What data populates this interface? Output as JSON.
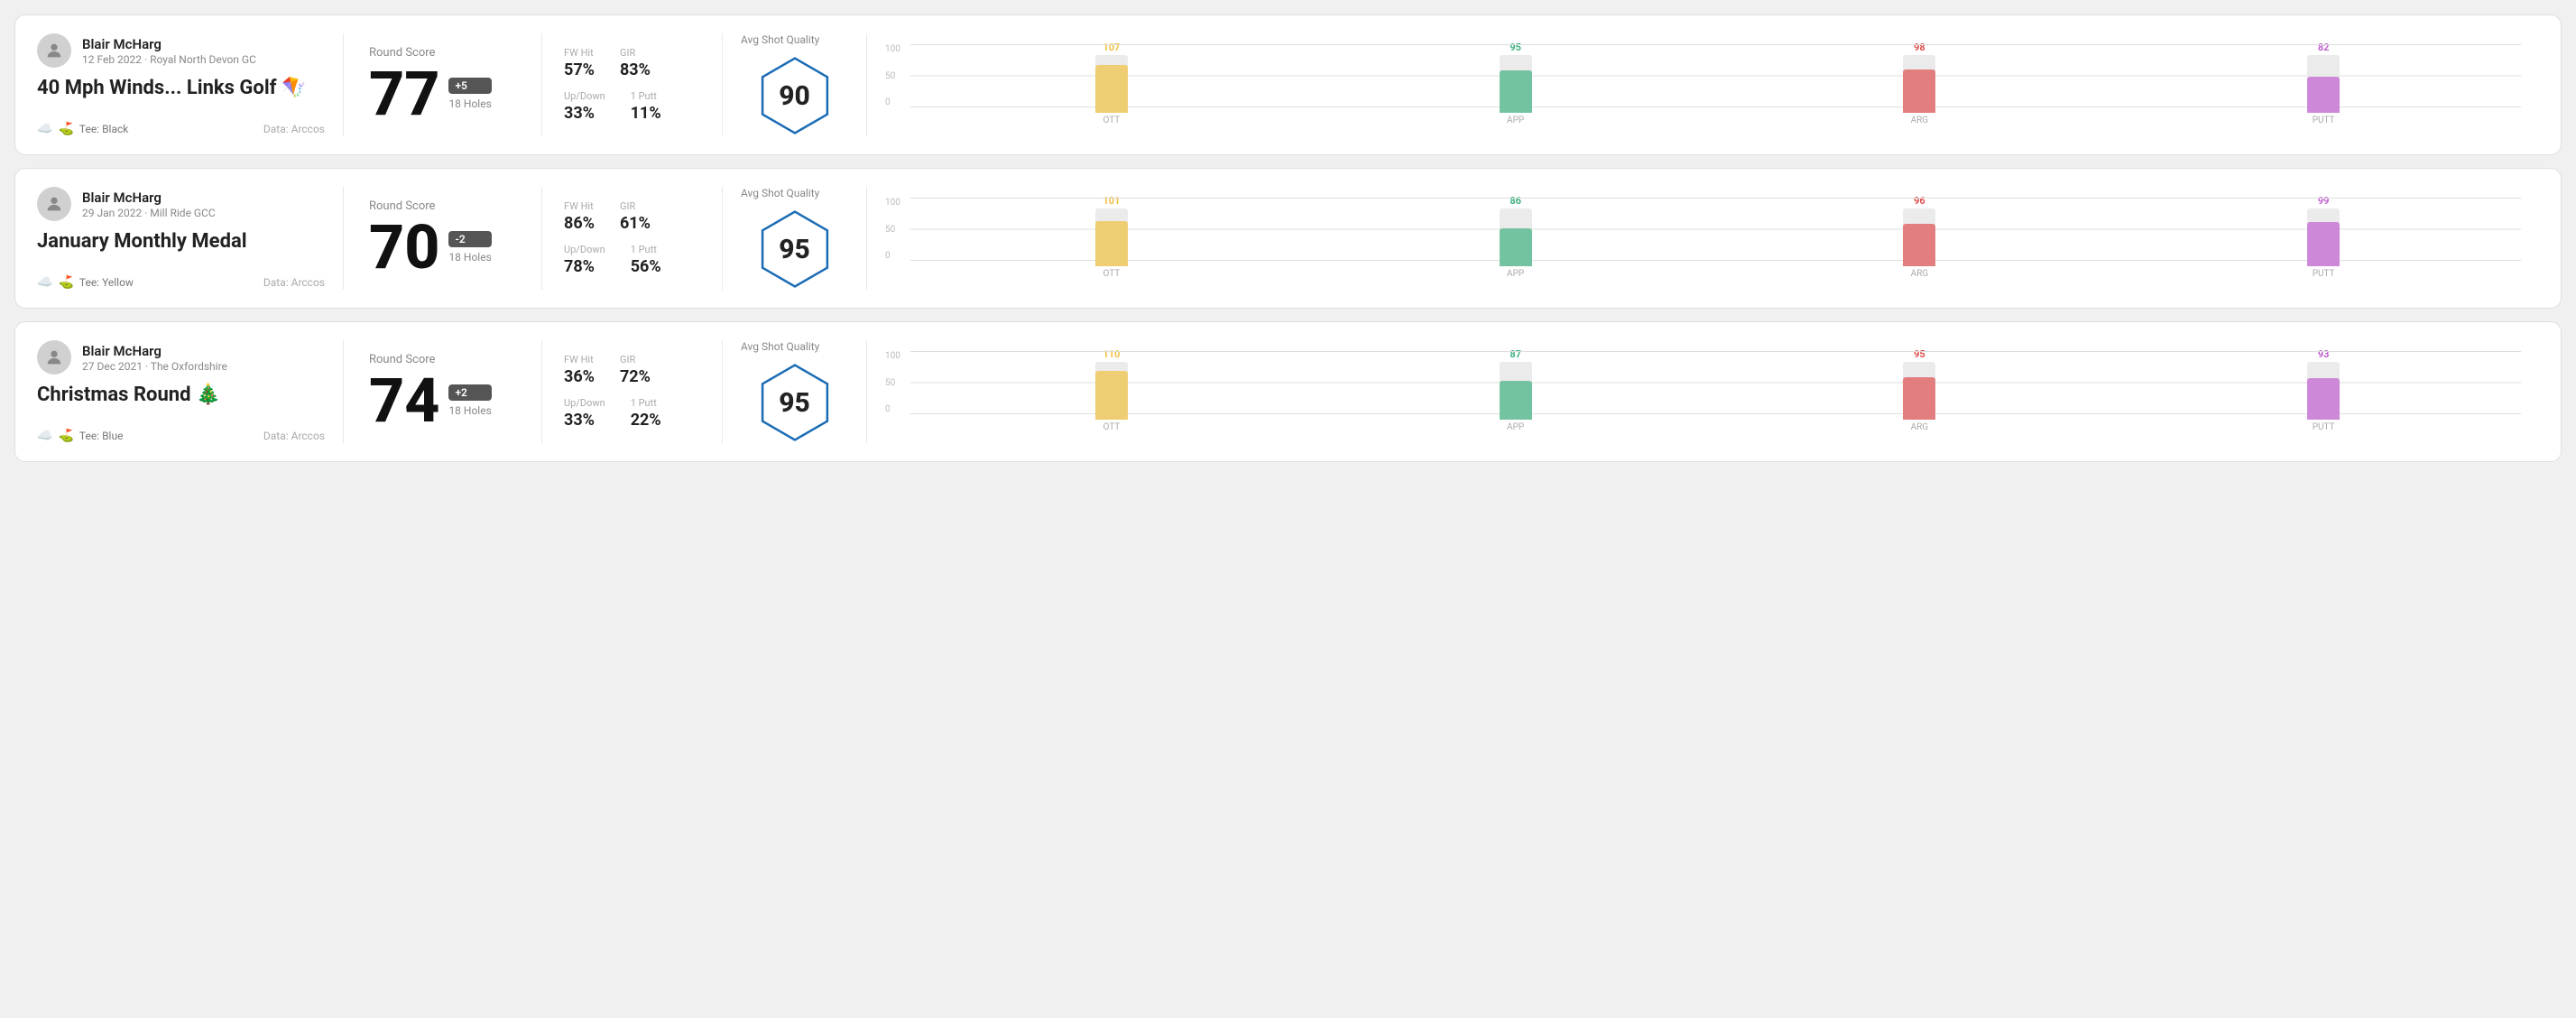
{
  "rounds": [
    {
      "id": "round-1",
      "user": {
        "name": "Blair McHarg",
        "date_course": "12 Feb 2022 · Royal North Devon GC"
      },
      "title": "40 Mph Winds... Links Golf 🪁",
      "tee": "Black",
      "data_source": "Data: Arccos",
      "score": "77",
      "score_diff": "+5",
      "holes": "18 Holes",
      "fw_hit": "57%",
      "gir": "83%",
      "up_down": "33%",
      "one_putt": "11%",
      "avg_quality": "90",
      "quality_label": "Avg Shot Quality",
      "chart": {
        "bars": [
          {
            "label": "OTT",
            "value": 107,
            "color": "#f0c040",
            "max": 130
          },
          {
            "label": "APP",
            "value": 95,
            "color": "#40b080",
            "max": 130
          },
          {
            "label": "ARG",
            "value": 98,
            "color": "#e05050",
            "max": 130
          },
          {
            "label": "PUTT",
            "value": 82,
            "color": "#c060d0",
            "max": 130
          }
        ]
      }
    },
    {
      "id": "round-2",
      "user": {
        "name": "Blair McHarg",
        "date_course": "29 Jan 2022 · Mill Ride GCC"
      },
      "title": "January Monthly Medal",
      "tee": "Yellow",
      "data_source": "Data: Arccos",
      "score": "70",
      "score_diff": "-2",
      "holes": "18 Holes",
      "fw_hit": "86%",
      "gir": "61%",
      "up_down": "78%",
      "one_putt": "56%",
      "avg_quality": "95",
      "quality_label": "Avg Shot Quality",
      "chart": {
        "bars": [
          {
            "label": "OTT",
            "value": 101,
            "color": "#f0c040",
            "max": 130
          },
          {
            "label": "APP",
            "value": 86,
            "color": "#40b080",
            "max": 130
          },
          {
            "label": "ARG",
            "value": 96,
            "color": "#e05050",
            "max": 130
          },
          {
            "label": "PUTT",
            "value": 99,
            "color": "#c060d0",
            "max": 130
          }
        ]
      }
    },
    {
      "id": "round-3",
      "user": {
        "name": "Blair McHarg",
        "date_course": "27 Dec 2021 · The Oxfordshire"
      },
      "title": "Christmas Round 🎄",
      "tee": "Blue",
      "data_source": "Data: Arccos",
      "score": "74",
      "score_diff": "+2",
      "holes": "18 Holes",
      "fw_hit": "36%",
      "gir": "72%",
      "up_down": "33%",
      "one_putt": "22%",
      "avg_quality": "95",
      "quality_label": "Avg Shot Quality",
      "chart": {
        "bars": [
          {
            "label": "OTT",
            "value": 110,
            "color": "#f0c040",
            "max": 130
          },
          {
            "label": "APP",
            "value": 87,
            "color": "#40b080",
            "max": 130
          },
          {
            "label": "ARG",
            "value": 95,
            "color": "#e05050",
            "max": 130
          },
          {
            "label": "PUTT",
            "value": 93,
            "color": "#c060d0",
            "max": 130
          }
        ]
      }
    }
  ],
  "labels": {
    "round_score": "Round Score",
    "fw_hit": "FW Hit",
    "gir": "GIR",
    "up_down": "Up/Down",
    "one_putt": "1 Putt",
    "data_arccos": "Data: Arccos",
    "tee": "Tee:",
    "y_axis_100": "100",
    "y_axis_50": "50",
    "y_axis_0": "0"
  }
}
